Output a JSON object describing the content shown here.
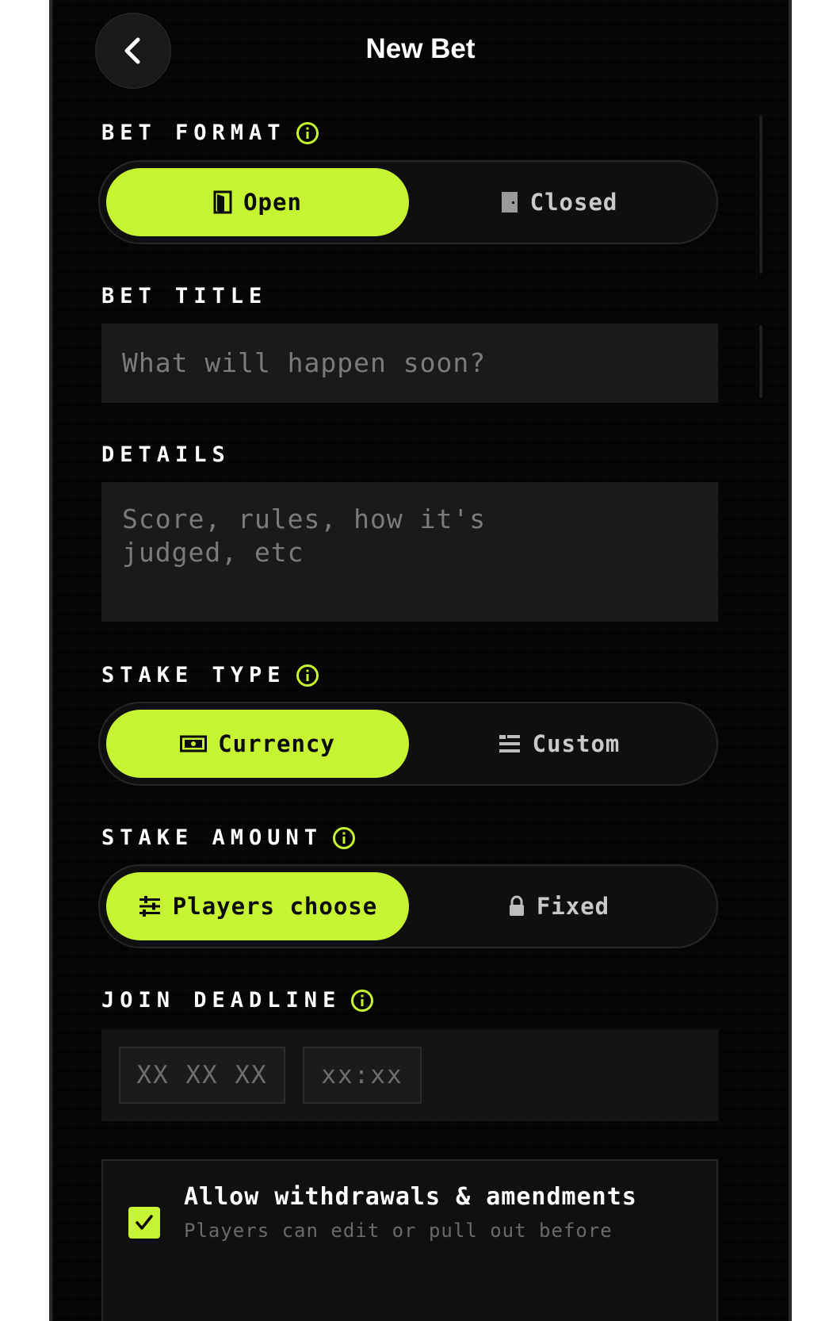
{
  "header": {
    "title": "New Bet"
  },
  "bet_format": {
    "label": "BET FORMAT",
    "options": [
      {
        "label": "Open",
        "icon": "door-open-icon",
        "selected": true
      },
      {
        "label": "Closed",
        "icon": "door-closed-icon",
        "selected": false
      }
    ]
  },
  "bet_title": {
    "label": "BET TITLE",
    "placeholder": "What will happen soon?"
  },
  "details": {
    "label": "DETAILS",
    "placeholder_line1": "Score, rules, how it's",
    "placeholder_line2": "judged, etc"
  },
  "stake_type": {
    "label": "STAKE TYPE",
    "options": [
      {
        "label": "Currency",
        "icon": "banknote-icon",
        "selected": true
      },
      {
        "label": "Custom",
        "icon": "list-icon",
        "selected": false
      }
    ]
  },
  "stake_amount": {
    "label": "STAKE AMOUNT",
    "options": [
      {
        "label": "Players choose",
        "icon": "sliders-icon",
        "selected": true
      },
      {
        "label": "Fixed",
        "icon": "lock-icon",
        "selected": false
      }
    ]
  },
  "join_deadline": {
    "label": "JOIN DEADLINE",
    "date_placeholder": "XX XX XX",
    "time_placeholder": "xx:xx"
  },
  "withdrawals": {
    "checked": true,
    "title": "Allow withdrawals & amendments",
    "subtitle": "Players can edit or pull out before"
  },
  "colors": {
    "accent": "#c6f432",
    "background": "#050505",
    "field": "#1a1a1a"
  }
}
